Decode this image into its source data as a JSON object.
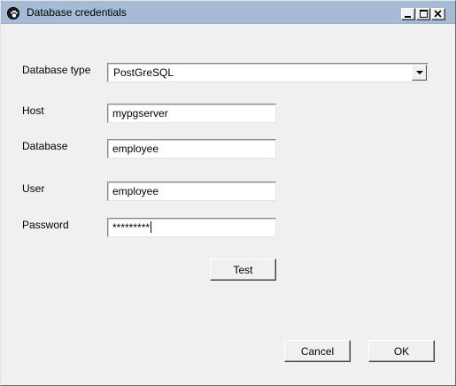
{
  "window": {
    "title": "Database credentials",
    "icon": "paw-icon",
    "controls": [
      "minimize-icon",
      "maximize-icon",
      "close-icon"
    ]
  },
  "form": {
    "database_type": {
      "label": "Database type",
      "value": "PostGreSQL"
    },
    "host": {
      "label": "Host",
      "value": "mypgserver"
    },
    "database": {
      "label": "Database",
      "value": "employee"
    },
    "user": {
      "label": "User",
      "value": "employee"
    },
    "password": {
      "label": "Password",
      "value": "*********"
    }
  },
  "buttons": {
    "test": "Test",
    "cancel": "Cancel",
    "ok": "OK"
  }
}
